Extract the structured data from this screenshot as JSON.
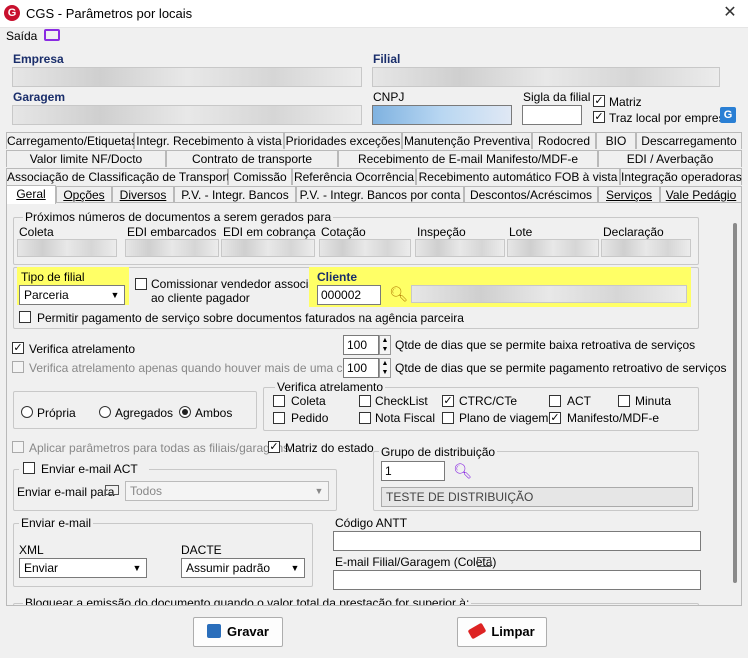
{
  "window": {
    "title": "CGS - Parâmetros por locais",
    "logo_letter": "G",
    "close_glyph": "✕"
  },
  "menu": {
    "saida": "Saída"
  },
  "header": {
    "empresa_label": "Empresa",
    "filial_label": "Filial",
    "garagem_label": "Garagem",
    "cnpj_label": "CNPJ",
    "sigla_label": "Sigla da filial",
    "matriz_label": "Matriz",
    "traz_local_label": "Traz local por empresa",
    "matriz_checked": true,
    "traz_local_checked": true
  },
  "tabs": {
    "row1": [
      "Carregamento/Etiquetas",
      "Integr. Recebimento à vista",
      "Prioridades exceções",
      "Manutenção Preventiva",
      "Rodocred",
      "BIO",
      "Descarregamento"
    ],
    "row2": [
      "Valor limite NF/Docto",
      "Contrato de transporte",
      "Recebimento de E-mail Manifesto/MDF-e",
      "EDI / Averbação"
    ],
    "row3": [
      "Associação de Classificação de Transporte",
      "Comissão",
      "Referência Ocorrência",
      "Recebimento automático FOB à vista",
      "Integração operadoras"
    ],
    "row4": [
      "Geral",
      "Opções",
      "Diversos",
      "P.V. - Integr. Bancos",
      "P.V. - Integr. Bancos por conta",
      "Descontos/Acréscimos",
      "Serviços",
      "Vale Pedágio"
    ],
    "active": "Geral"
  },
  "proximos": {
    "title": "Próximos números de documentos a serem gerados para",
    "columns": [
      "Coleta",
      "EDI embarcados",
      "EDI em cobrança",
      "Cotação",
      "Inspeção",
      "Lote",
      "Declaração"
    ]
  },
  "tipo_filial": {
    "label": "Tipo de filial",
    "value": "Parceria"
  },
  "comissionar": {
    "line1": "Comissionar vendedor associado",
    "line2": "ao cliente pagador",
    "checked": false
  },
  "cliente": {
    "label": "Cliente",
    "code": "000002"
  },
  "permitir_pagamento": {
    "label": "Permitir pagamento de serviço sobre documentos faturados na agência parceira",
    "checked": false
  },
  "verifica_atrelamento": {
    "label": "Verifica atrelamento",
    "checked": true
  },
  "verifica_carreta": {
    "label": "Verifica atrelamento apenas quando houver mais de uma carreta",
    "checked": false
  },
  "dias_baixa": {
    "value": "100",
    "label": "Qtde de dias que se permite baixa retroativa de serviços"
  },
  "dias_pagamento": {
    "value": "100",
    "label": "Qtde de dias que se permite pagamento retroativo de serviços"
  },
  "frota": {
    "options": [
      "Própria",
      "Agregados",
      "Ambos"
    ],
    "selected": "Ambos"
  },
  "verifica_group": {
    "title": "Verifica atrelamento",
    "items": [
      {
        "label": "Coleta",
        "checked": false
      },
      {
        "label": "CheckList",
        "checked": false
      },
      {
        "label": "CTRC/CTe",
        "checked": true
      },
      {
        "label": "ACT",
        "checked": false
      },
      {
        "label": "Minuta",
        "checked": false
      },
      {
        "label": "Pedido",
        "checked": false
      },
      {
        "label": "Nota Fiscal",
        "checked": false
      },
      {
        "label": "Plano de viagem",
        "checked": false
      },
      {
        "label": "Manifesto/MDF-e",
        "checked": true
      }
    ]
  },
  "aplicar_parametros": {
    "label": "Aplicar parâmetros para todas as filiais/garagens",
    "checked": false
  },
  "matriz_estado": {
    "label": "Matriz do estado",
    "checked": true
  },
  "grupo_distribuicao": {
    "title": "Grupo de distribuição",
    "code": "1",
    "description": "TESTE DE DISTRIBUIÇÃO"
  },
  "enviar_act": {
    "label": "Enviar e-mail ACT",
    "checked": false,
    "para_label": "Enviar e-mail para",
    "para_value": "Todos"
  },
  "enviar_email": {
    "title": "Enviar e-mail",
    "xml_label": "XML",
    "xml_value": "Enviar",
    "dacte_label": "DACTE",
    "dacte_value": "Assumir padrão"
  },
  "antt": {
    "label": "Código ANTT"
  },
  "email_filial": {
    "label": "E-mail Filial/Garagem (Coleta)"
  },
  "bloqueio": {
    "label": "Bloquear a emissão do documento quando o valor total da prestação for superior à:"
  },
  "buttons": {
    "gravar": "Gravar",
    "limpar": "Limpar"
  },
  "colors": {
    "accent": "#c8102e",
    "highlight": "#ffff66",
    "monitor_icon": "#8a2be2"
  }
}
